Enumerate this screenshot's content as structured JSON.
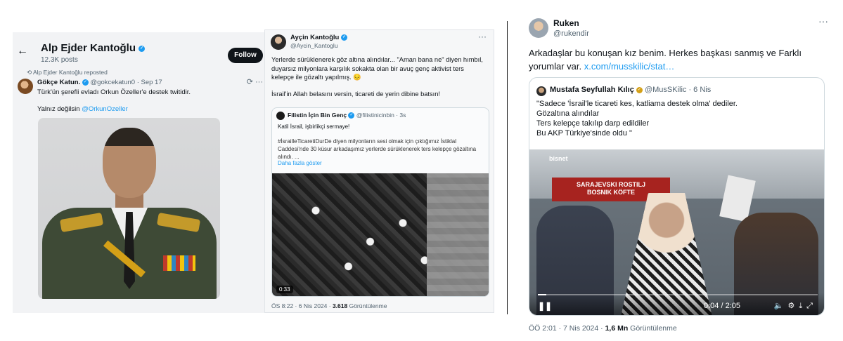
{
  "panel1": {
    "back_icon": "arrow-left-icon",
    "profile_name": "Alp Ejder Kantoğlu",
    "posts_count": "12.3K posts",
    "follow_label": "Follow",
    "reposted_by": "Alp Ejder Kantoğlu reposted",
    "tweet": {
      "author_name": "Gökçe Katun.",
      "author_handle": "@gokcekatun0",
      "date": "· Sep 17",
      "text1": "Türk'ün şerefli evladı Orkun Özeller'e destek twitidir.",
      "text2_prefix": "Yalnız değilsin ",
      "mention": "@OrkunOzeller"
    }
  },
  "panel2": {
    "author_name": "Ayçin Kantoğlu",
    "author_handle": "@Aycin_Kantoglu",
    "more": "···",
    "text1": "Yerlerde sürüklenerek göz altına alındılar... \"Aman bana ne\" diyen hımbıl, duyarsız milyonlara karşılık sokakta olan bir avuç genç aktivist ters kelepçe ile gözaltı yapılmış. 😔",
    "text2": "İsrail'in Allah belasını versin, ticareti de yerin dibine batsın!",
    "quote": {
      "author_name": "Filistin İçin Bin Genç",
      "author_handle": "@filistinicinbin",
      "time": "· 3s",
      "line1": "Katil İsrail, işbirlikçi sermaye!",
      "line2": "#İsrailleTicaretiDurDe diyen milyonların sesi olmak için çıktığımız İstiklal Caddesi'nde 30 küsur arkadaşımız yerlerde sürüklenerek ters kelepçe gözaltına alındı. ...",
      "show_more": "Daha fazla göster",
      "duration": "0:33"
    },
    "footer_time": "ÖS 8:22 · 6 Nis 2024 · ",
    "footer_views": "3.618",
    "footer_views_label": " Görüntülenme"
  },
  "panel3": {
    "author_name": "Ruken",
    "author_handle": "@rukendir",
    "more": "···",
    "text": "Arkadaşlar bu konuşan kız benim. Herkes başkası sanmış ve Farklı yorumlar var. ",
    "link": "x.com/musskilic/stat…",
    "quote": {
      "author_name": "Mustafa Seyfullah Kılıç",
      "author_handle": "@MusSKilic",
      "time": "· 6 Nis",
      "line1": "\"Sadece 'İsrail'le ticareti kes, katliama destek olma' dediler.",
      "line2": " Gözaltına alındılar",
      "line3": "Ters kelepçe takılıp darp edildiler",
      "line4": "Bu AKP Türkiye'sinde oldu \"",
      "video_tag": "bisnet",
      "sign_line1": "SARAJEVSKI ROSTILJ",
      "sign_line2": "BOSNIK KÖFTE",
      "time_display": "0:04 / 2:05",
      "progress_pct": 3
    },
    "footer_time": "ÖÖ 2:01 · 7 Nis 2024 · ",
    "footer_views": "1,6 Mn",
    "footer_views_label": " Görüntülenme"
  }
}
